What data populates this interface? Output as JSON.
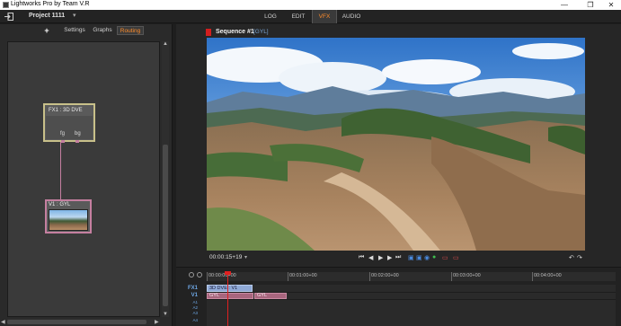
{
  "window": {
    "title": "Lightworks Pro by Team V.R",
    "buttons": [
      "—",
      "❐",
      "✕"
    ]
  },
  "appbar": {
    "project": "Project 1111",
    "project_chevron": "▾",
    "rooms": [
      "LOG",
      "EDIT",
      "VFX",
      "AUDIO"
    ],
    "active_room": "VFX",
    "accent": "#ff8c2a"
  },
  "left_panel": {
    "plus": "+",
    "tabs": [
      "Settings",
      "Graphs",
      "Routing"
    ],
    "active_tab": "Routing",
    "fx_node": {
      "label": "FX1 : 3D DVE",
      "ports": [
        "fg",
        "bg"
      ]
    },
    "video_node": {
      "label": "V1 : GYL"
    },
    "scroll": {
      "up": "▲",
      "down": "▼",
      "left": "◀",
      "right": "▶"
    }
  },
  "viewer": {
    "sequence_title": "Sequence #1",
    "sequence_sub": "[GYL]",
    "timecode": "00:00:15+19",
    "timecode_chevron": "▾",
    "transport": [
      "⏮",
      "◀",
      "▶",
      "▶",
      "⏭"
    ],
    "extra_controls": [
      "▣",
      "▣",
      "◉",
      "●"
    ],
    "mark_controls": [
      "▭",
      "▭"
    ],
    "loop_controls": [
      "↶",
      "↷"
    ]
  },
  "timeline": {
    "ticks": [
      "00:00:00+00",
      "00:01:00+00",
      "00:02:00+00",
      "00:03:00+00",
      "00:04:00+00"
    ],
    "tracks": [
      "FX1",
      "V1",
      "A1",
      "A2",
      "A3",
      "A4"
    ],
    "fx_clip": "3D DVE : V1",
    "video_clips": [
      "GYL",
      "GYL"
    ],
    "playhead_color": "#e02020"
  }
}
